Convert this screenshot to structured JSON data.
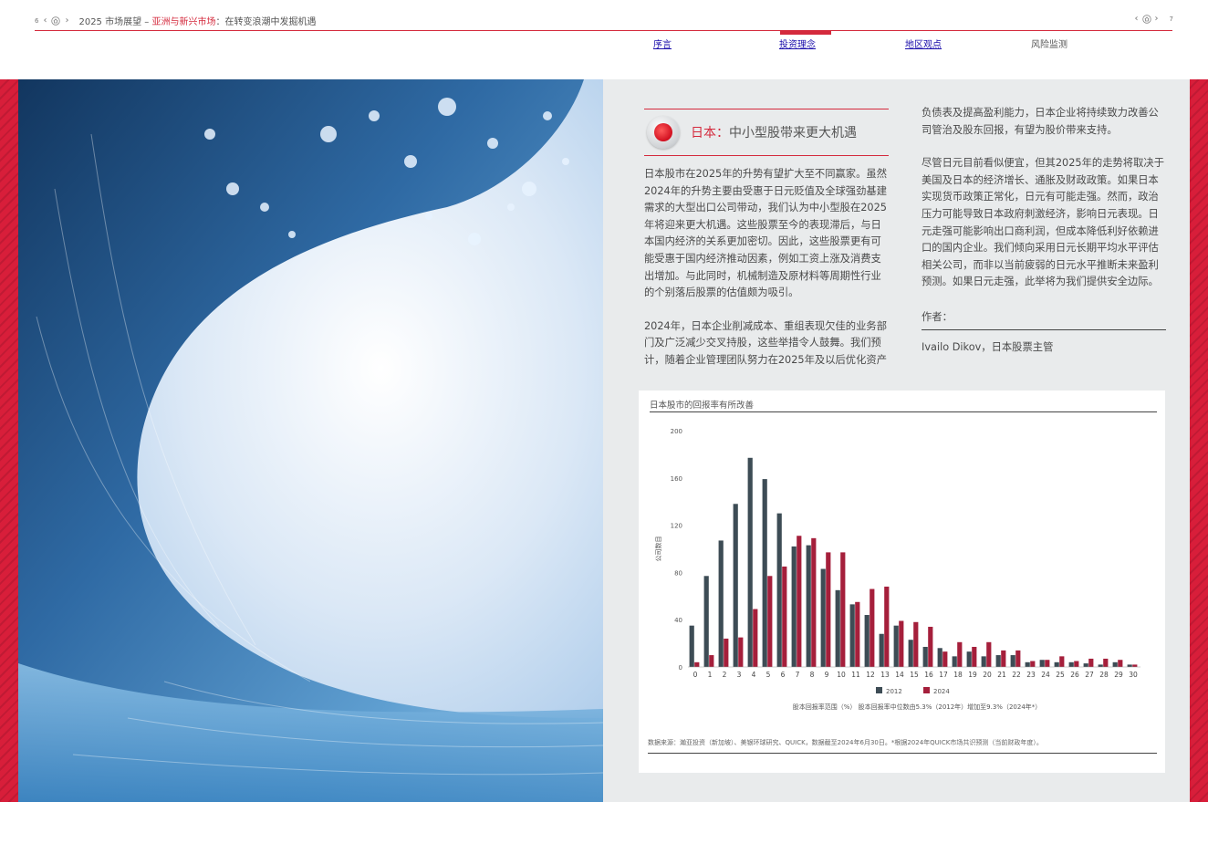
{
  "header": {
    "page_left": "6",
    "page_right": "7",
    "title_prefix": "2025 市场展望 – ",
    "title_red": "亚洲与新兴市场",
    "title_suffix": "：在转变浪潮中发掘机遇"
  },
  "tabs": [
    {
      "label": "序言"
    },
    {
      "label": "投资理念"
    },
    {
      "label": "地区观点"
    },
    {
      "label": "风险监测"
    }
  ],
  "article": {
    "heading_red": "日本：",
    "heading_rest": "中小型股带来更大机遇",
    "col1_p1": "日本股市在2025年的升势有望扩大至不同赢家。虽然2024年的升势主要由受惠于日元贬值及全球强劲基建需求的大型出口公司带动，我们认为中小型股在2025年将迎来更大机遇。这些股票至今的表现滞后，与日本国内经济的关系更加密切。因此，这些股票更有可能受惠于国内经济推动因素，例如工资上涨及消费支出增加。与此同时，机械制造及原材料等周期性行业的个别落后股票的估值颇为吸引。",
    "col1_p2": "2024年，日本企业削减成本、重组表现欠佳的业务部门及广泛减少交叉持股，这些举措令人鼓舞。我们预计，随着企业管理团队努力在2025年及以后优化资产",
    "col2_p1": "负债表及提高盈利能力，日本企业将持续致力改善公司管治及股东回报，有望为股价带来支持。",
    "col2_p2": "尽管日元目前看似便宜，但其2025年的走势将取决于美国及日本的经济增长、通胀及财政政策。如果日本实现货币政策正常化，日元有可能走强。然而，政治压力可能导致日本政府刺激经济，影响日元表现。日元走强可能影响出口商利润，但成本降低利好依赖进口的国内企业。我们倾向采用日元长期平均水平评估相关公司，而非以当前疲弱的日元水平推断未来盈利预测。如果日元走强，此举将为我们提供安全边际。",
    "author_label": "作者：",
    "author_name": "Ivailo Dikov，日本股票主管"
  },
  "chart": {
    "title": "日本股市的回报率有所改善",
    "source": "数据来源：瀚亚投资（新加坡）、美银环球研究、QUICK，数据截至2024年6月30日。*根据2024年QUICK市场共识预测（当前财政年度）。"
  },
  "chart_data": {
    "type": "bar",
    "ylabel": "公司数目",
    "xlabel": "股本回报率范围（%）  股本回报率中位数由5.3%（2012年）增加至9.3%（2024年*）",
    "ylim": [
      0,
      200
    ],
    "yticks": [
      0,
      40,
      80,
      120,
      160,
      200
    ],
    "categories": [
      "0",
      "1",
      "2",
      "3",
      "4",
      "5",
      "6",
      "7",
      "8",
      "9",
      "10",
      "11",
      "12",
      "13",
      "14",
      "15",
      "16",
      "17",
      "18",
      "19",
      "20",
      "21",
      "22",
      "23",
      "24",
      "25",
      "26",
      "27",
      "28",
      "29",
      "30"
    ],
    "series": [
      {
        "name": "2012",
        "color": "#3d4c55",
        "values": [
          35,
          77,
          107,
          138,
          177,
          159,
          130,
          102,
          103,
          83,
          65,
          53,
          44,
          28,
          35,
          23,
          17,
          16,
          9,
          13,
          9,
          10,
          10,
          4,
          6,
          4,
          4,
          3,
          2,
          4,
          2
        ]
      },
      {
        "name": "2024",
        "color": "#a51f3b",
        "values": [
          4,
          10,
          24,
          25,
          49,
          77,
          85,
          111,
          109,
          97,
          97,
          55,
          66,
          68,
          39,
          38,
          34,
          13,
          21,
          17,
          21,
          14,
          14,
          5,
          6,
          9,
          5,
          7,
          7,
          6,
          2
        ]
      }
    ],
    "legend_position": "bottom",
    "grid": false
  }
}
